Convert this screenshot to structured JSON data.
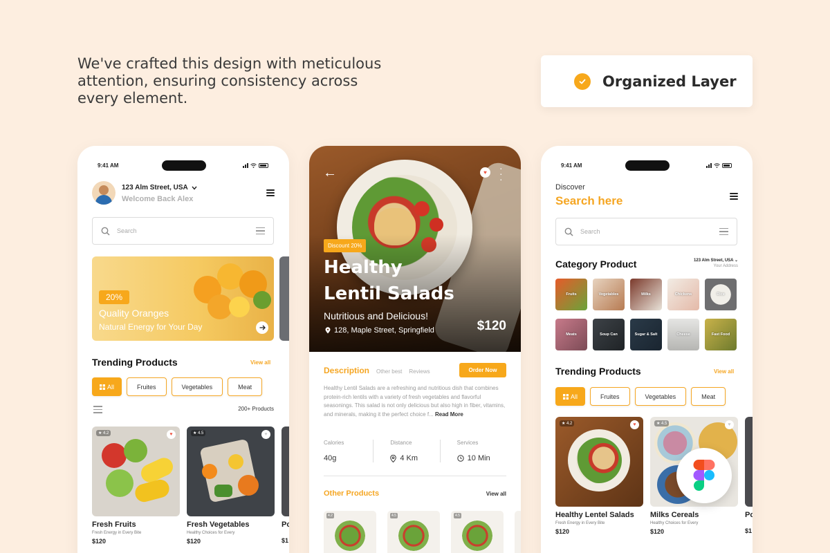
{
  "headline": "We've crafted this design with meticulous attention, ensuring consistency across every element.",
  "badge": {
    "label": "Organized Layer",
    "icon": "check-circle-icon",
    "accent": "#f7a81b"
  },
  "status": {
    "time": "9:41 AM"
  },
  "home": {
    "location": "123 Alm Street, USA",
    "welcome": "Welcome Back Alex",
    "search_placeholder": "Search",
    "banner": {
      "discount": "20%",
      "title": "Quality Oranges",
      "subtitle": "Natural Energy for Your Day"
    },
    "trending_title": "Trending Products",
    "view_all": "View all",
    "chips": [
      "All",
      "Fruites",
      "Vegetables",
      "Meat"
    ],
    "product_count": "200+ Products",
    "products": [
      {
        "rating": "4.2",
        "name": "Fresh Fruits",
        "sub": "Fresh Energy in Every Bite",
        "price": "$120"
      },
      {
        "rating": "4.5",
        "name": "Fresh Vegetables",
        "sub": "Healthy Choices for Every",
        "price": "$120"
      },
      {
        "name": "Po",
        "price": "$1"
      }
    ]
  },
  "detail": {
    "discount": "Discount 20%",
    "title": "Healthy Lentil Salads",
    "subtitle": "Nutritious and Delicious!",
    "location": "128, Maple Street, Springfield",
    "price": "$120",
    "tabs": [
      "Description",
      "Other best",
      "Reviews"
    ],
    "order_button": "Order Now",
    "description": "Healthy Lentil Salads are a refreshing and nutritious dish that combines protein-rich lentils with a variety of fresh vegetables and flavorful seasonings. This salad is not only delicious but also high in fiber, vitamins, and minerals, making it the perfect choice f...",
    "read_more": "Read More",
    "stats": [
      {
        "label": "Calories",
        "value": "40g"
      },
      {
        "label": "Distance",
        "value": "4 Km"
      },
      {
        "label": "Services",
        "value": "10 Min"
      }
    ],
    "other_title": "Other  Products",
    "other_view_all": "View all",
    "thumb_ratings": [
      "4.2",
      "4.5",
      "4.5"
    ]
  },
  "discover": {
    "discover_label": "Discover",
    "search_here": "Search here",
    "search_placeholder": "Search",
    "category_title": "Category Product",
    "address": "123 Alm Street, USA",
    "address_sub": "Your Address",
    "categories": [
      "Fruits",
      "Vegetables",
      "Milks",
      "Chickens",
      "Rice",
      "Meats",
      "Soup Can",
      "Sugar & Salt",
      "Cheese",
      "Fast Food"
    ],
    "trending_title": "Trending Products",
    "view_all": "View all",
    "chips": [
      "All",
      "Fruites",
      "Vegetables",
      "Meat"
    ],
    "products": [
      {
        "rating": "4.2",
        "name": "Healthy Lentel Salads",
        "sub": "Fresh Energy in Every Bite",
        "price": "$120"
      },
      {
        "rating": "4.5",
        "name": "Milks Cereals",
        "sub": "Healthy Choices for Every",
        "price": "$120"
      },
      {
        "name": "Po",
        "price": "$1"
      }
    ]
  }
}
